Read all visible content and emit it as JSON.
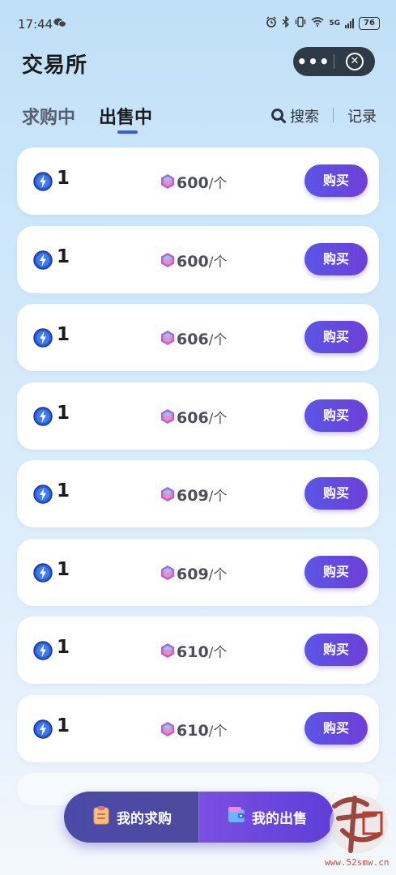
{
  "status_bar": {
    "time": "17:44",
    "network": "5G",
    "battery": "76"
  },
  "header": {
    "title": "交易所",
    "capsule_more": "•••",
    "capsule_close": "⊗"
  },
  "tabs": {
    "buy": "求购中",
    "sell": "出售中",
    "active": "sell"
  },
  "tools": {
    "search_label": "搜索",
    "record_label": "记录"
  },
  "listings": [
    {
      "qty": "1",
      "price": "600",
      "unit": "/个",
      "action": "购买"
    },
    {
      "qty": "1",
      "price": "600",
      "unit": "/个",
      "action": "购买"
    },
    {
      "qty": "1",
      "price": "606",
      "unit": "/个",
      "action": "购买"
    },
    {
      "qty": "1",
      "price": "606",
      "unit": "/个",
      "action": "购买"
    },
    {
      "qty": "1",
      "price": "609",
      "unit": "/个",
      "action": "购买"
    },
    {
      "qty": "1",
      "price": "609",
      "unit": "/个",
      "action": "购买"
    },
    {
      "qty": "1",
      "price": "610",
      "unit": "/个",
      "action": "购买"
    },
    {
      "qty": "1",
      "price": "610",
      "unit": "/个",
      "action": "购买"
    }
  ],
  "bottom_bar": {
    "my_buy": "我的求购",
    "my_sell": "我的出售"
  },
  "watermark": {
    "site": "www.52smw.cn"
  },
  "colors": {
    "accent": "#5b55e6",
    "capsule": "#2f3a47",
    "tab_indicator": "#3b5bdb"
  }
}
